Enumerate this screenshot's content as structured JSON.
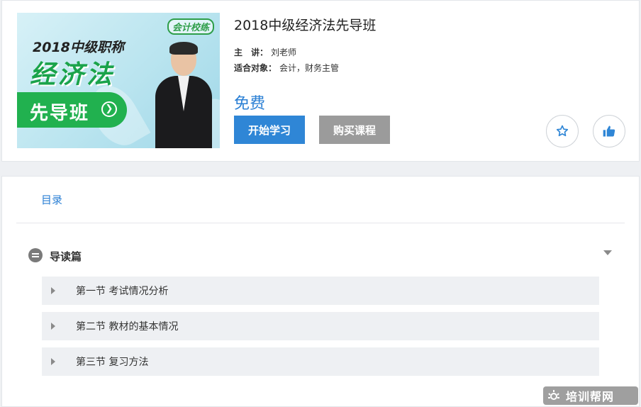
{
  "course": {
    "title": "2018中级经济法先导班",
    "lecturer_label": "主　讲：",
    "lecturer": "刘老师",
    "audience_label": "适合对象：",
    "audience": "会计，财务主管",
    "price": "免费"
  },
  "banner": {
    "logo_text": "会计校练",
    "line1": "2018中级职称",
    "line2": "经济法",
    "pill": "先导班"
  },
  "actions": {
    "start_label": "开始学习",
    "buy_label": "购买课程",
    "favorite_icon": "star-icon",
    "like_icon": "thumbs-up-icon"
  },
  "catalog": {
    "tab_label": "目录",
    "section_title": "导读篇",
    "lessons": [
      {
        "title": "第一节 考试情况分析"
      },
      {
        "title": "第二节 教材的基本情况"
      },
      {
        "title": "第三节 复习方法"
      }
    ]
  },
  "watermark": {
    "text": "培训帮网"
  },
  "colors": {
    "primary": "#2f86d6",
    "disabled": "#9b9b9b",
    "banner_green": "#21b14f"
  }
}
